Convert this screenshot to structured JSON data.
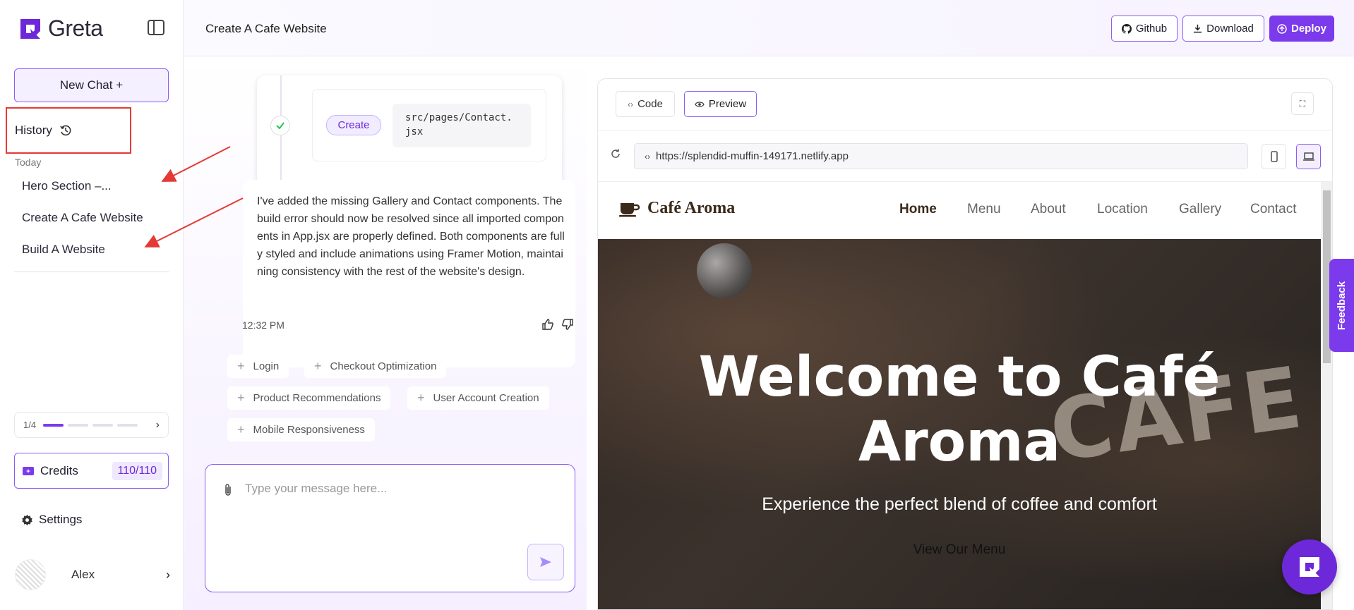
{
  "app": {
    "name": "Greta",
    "title": "Create A Cafe Website"
  },
  "sidebar": {
    "new_chat_label": "New Chat +",
    "history_label": "History",
    "group_label": "Today",
    "items": [
      {
        "label": "Hero Section –..."
      },
      {
        "label": "Create A Cafe Website"
      },
      {
        "label": "Build A Website"
      }
    ],
    "pager": {
      "label": "1/4",
      "current": 1,
      "total": 4
    },
    "credits": {
      "label": "Credits",
      "value": "110/110"
    },
    "settings_label": "Settings",
    "user": {
      "name": "Alex"
    }
  },
  "topbar": {
    "github_label": "Github",
    "download_label": "Download",
    "deploy_label": "Deploy"
  },
  "chat": {
    "task": {
      "action": "Create",
      "path": "src/pages/Contact.jsx"
    },
    "message": "I've added the missing Gallery and Contact components. The build error should now be resolved since all imported components in App.jsx are properly defined. Both components are fully styled and include animations using Framer Motion, maintaining consistency with the rest of the website's design.",
    "time": "12:32 PM",
    "suggestions": [
      "Login",
      "Checkout Optimization",
      "Product Recommendations",
      "User Account Creation",
      "Mobile Responsiveness"
    ],
    "input_placeholder": "Type your message here..."
  },
  "preview": {
    "code_tab": "Code",
    "preview_tab": "Preview",
    "active_tab": "Preview",
    "url": "https://splendid-muffin-149171.netlify.app",
    "active_device": "desktop",
    "site": {
      "logo": "Café Aroma",
      "nav": [
        "Home",
        "Menu",
        "About",
        "Location",
        "Gallery",
        "Contact"
      ],
      "active_nav": "Home",
      "hero_title": "Welcome to Café Aroma",
      "hero_subtitle": "Experience the perfect blend of coffee and comfort",
      "cta": "View Our Menu"
    }
  },
  "feedback_label": "Feedback",
  "colors": {
    "accent": "#7c3aed",
    "annotation": "#e53935"
  }
}
